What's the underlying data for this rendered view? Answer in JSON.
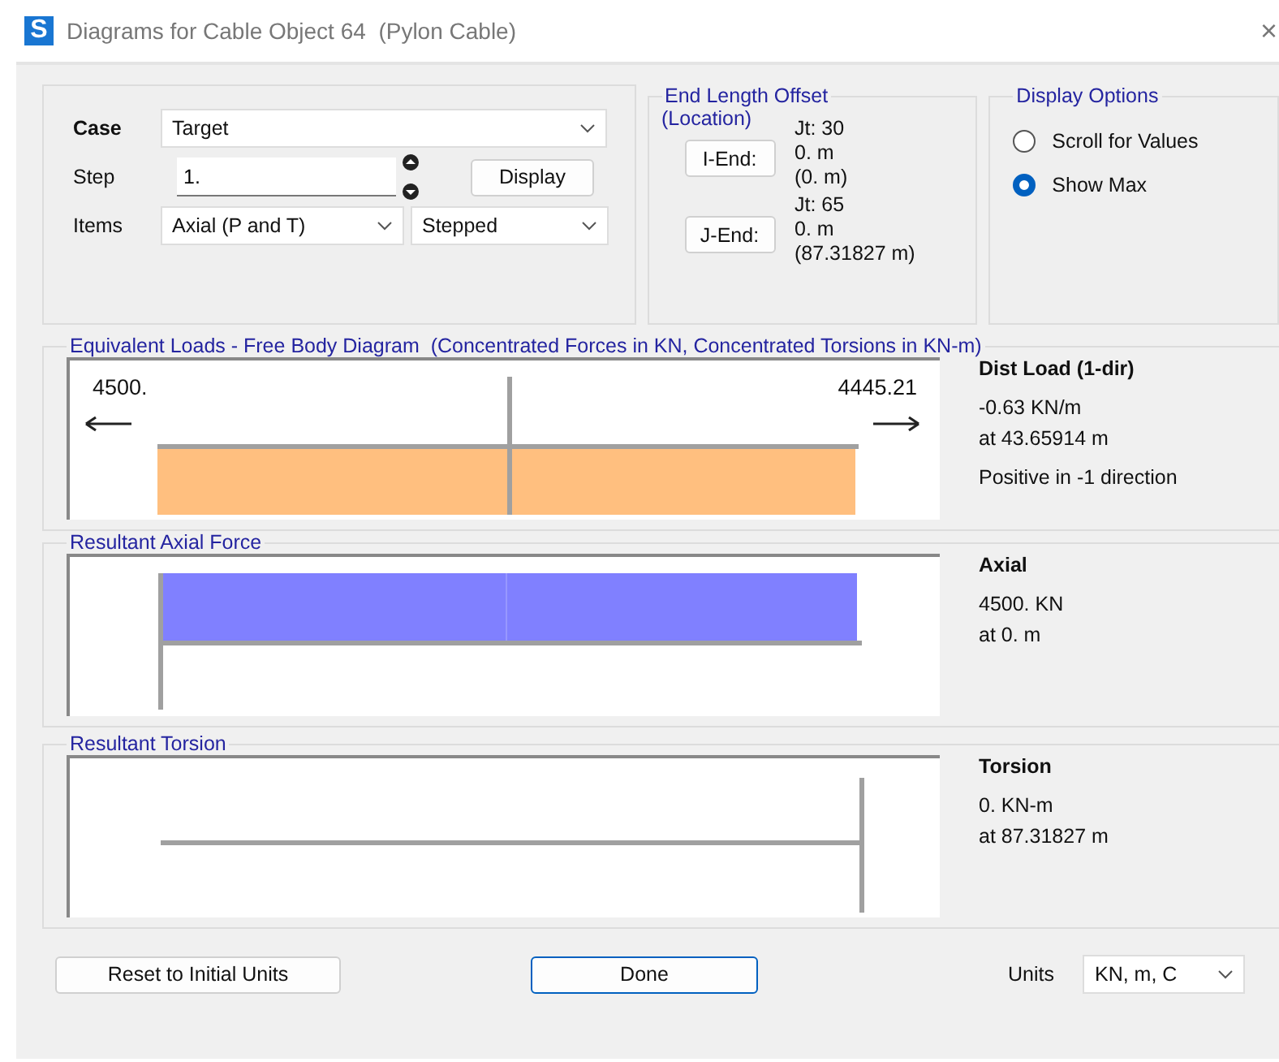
{
  "window": {
    "title": "Diagrams for Cable Object 64  (Pylon Cable)",
    "app_letter": "S",
    "close": "×"
  },
  "case_group": {
    "case_label": "Case",
    "case_value": "Target",
    "step_label": "Step",
    "step_value": "1.",
    "display_button": "Display",
    "items_label": "Items",
    "items_value": "Axial (P and T)",
    "mode_value": "Stepped"
  },
  "end_length_offset": {
    "title": "End Length Offset",
    "subtitle": "(Location)",
    "ends": [
      {
        "button": "I-End:",
        "joint": "Jt:  30",
        "offset": "0. m",
        "location": "(0. m)"
      },
      {
        "button": "J-End:",
        "joint": "Jt:  65",
        "offset": "0. m",
        "location": "(87.31827 m)"
      }
    ]
  },
  "display_options": {
    "title": "Display Options",
    "options": [
      {
        "label": "Scroll for Values",
        "selected": false
      },
      {
        "label": "Show Max",
        "selected": true
      }
    ]
  },
  "diagrams": [
    {
      "kind": "load",
      "title": "Equivalent Loads - Free Body Diagram  (Concentrated Forces in KN, Concentrated Torsions in KN-m)",
      "left_value": "4500.",
      "right_value": "4445.21",
      "heading": "Dist Load (1-dir)",
      "lines": [
        "-0.63 KN/m",
        "at 43.65914 m"
      ],
      "note": "Positive in -1 direction"
    },
    {
      "kind": "axial",
      "title": "Resultant Axial Force",
      "heading": "Axial",
      "lines": [
        "4500. KN",
        "at 0. m"
      ]
    },
    {
      "kind": "torsion",
      "title": "Resultant Torsion",
      "heading": "Torsion",
      "lines": [
        "0. KN-m",
        "at 87.31827 m"
      ]
    }
  ],
  "footer": {
    "reset_button": "Reset to Initial Units",
    "done_button": "Done",
    "units_label": "Units",
    "units_value": "KN, m, C"
  }
}
